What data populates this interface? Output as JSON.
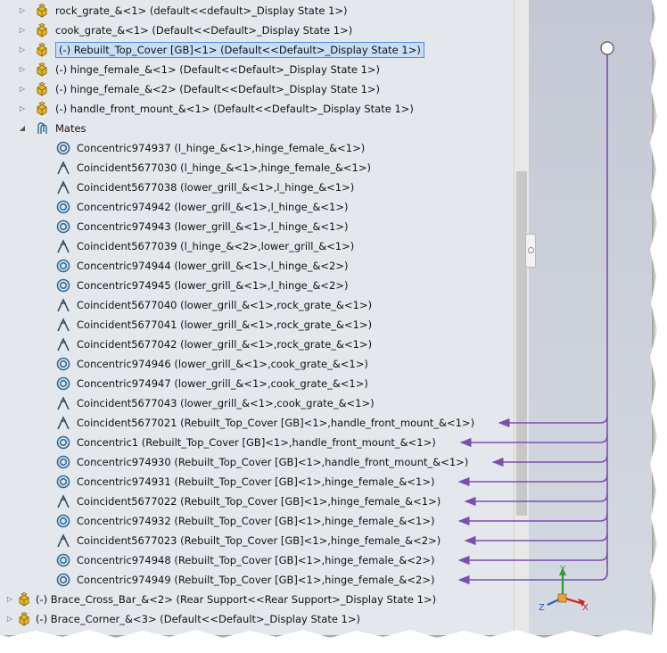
{
  "tree": {
    "rows": [
      {
        "label": "rock_grate_&<1> (default<<default>_Display State 1>)",
        "kind": "part",
        "expand": "right"
      },
      {
        "label": "cook_grate_&<1> (Default<<Default>_Display State 1>)",
        "kind": "part",
        "expand": "right"
      },
      {
        "label": "(-) Rebuilt_Top_Cover [GB]<1> (Default<<Default>_Display State 1>)",
        "kind": "part",
        "expand": "right",
        "selected": true
      },
      {
        "label": "(-) hinge_female_&<1> (Default<<Default>_Display State 1>)",
        "kind": "part",
        "expand": "right"
      },
      {
        "label": "(-) hinge_female_&<2> (Default<<Default>_Display State 1>)",
        "kind": "part",
        "expand": "right"
      },
      {
        "label": "(-) handle_front_mount_&<1> (Default<<Default>_Display State 1>)",
        "kind": "part",
        "expand": "right"
      },
      {
        "label": "Mates",
        "kind": "mates",
        "expand": "down"
      },
      {
        "label": "Concentric974937 (l_hinge_&<1>,hinge_female_&<1>)",
        "kind": "concentric"
      },
      {
        "label": "Coincident5677030 (l_hinge_&<1>,hinge_female_&<1>)",
        "kind": "coincident"
      },
      {
        "label": "Coincident5677038 (lower_grill_&<1>,l_hinge_&<1>)",
        "kind": "coincident"
      },
      {
        "label": "Concentric974942 (lower_grill_&<1>,l_hinge_&<1>)",
        "kind": "concentric"
      },
      {
        "label": "Concentric974943 (lower_grill_&<1>,l_hinge_&<1>)",
        "kind": "concentric"
      },
      {
        "label": "Coincident5677039 (l_hinge_&<2>,lower_grill_&<1>)",
        "kind": "coincident"
      },
      {
        "label": "Concentric974944 (lower_grill_&<1>,l_hinge_&<2>)",
        "kind": "concentric"
      },
      {
        "label": "Concentric974945 (lower_grill_&<1>,l_hinge_&<2>)",
        "kind": "concentric"
      },
      {
        "label": "Coincident5677040 (lower_grill_&<1>,rock_grate_&<1>)",
        "kind": "coincident"
      },
      {
        "label": "Coincident5677041 (lower_grill_&<1>,rock_grate_&<1>)",
        "kind": "coincident"
      },
      {
        "label": "Coincident5677042 (lower_grill_&<1>,rock_grate_&<1>)",
        "kind": "coincident"
      },
      {
        "label": "Concentric974946 (lower_grill_&<1>,cook_grate_&<1>)",
        "kind": "concentric"
      },
      {
        "label": "Concentric974947 (lower_grill_&<1>,cook_grate_&<1>)",
        "kind": "concentric"
      },
      {
        "label": "Coincident5677043 (lower_grill_&<1>,cook_grate_&<1>)",
        "kind": "coincident"
      },
      {
        "label": "Coincident5677021 (Rebuilt_Top_Cover [GB]<1>,handle_front_mount_&<1>)",
        "kind": "coincident",
        "arrow": true
      },
      {
        "label": "Concentric1 (Rebuilt_Top_Cover [GB]<1>,handle_front_mount_&<1>)",
        "kind": "concentric",
        "arrow": true
      },
      {
        "label": "Concentric974930 (Rebuilt_Top_Cover [GB]<1>,handle_front_mount_&<1>)",
        "kind": "concentric",
        "arrow": true
      },
      {
        "label": "Concentric974931 (Rebuilt_Top_Cover [GB]<1>,hinge_female_&<1>)",
        "kind": "concentric",
        "arrow": true
      },
      {
        "label": "Coincident5677022 (Rebuilt_Top_Cover [GB]<1>,hinge_female_&<1>)",
        "kind": "coincident",
        "arrow": true
      },
      {
        "label": "Concentric974932 (Rebuilt_Top_Cover [GB]<1>,hinge_female_&<1>)",
        "kind": "concentric",
        "arrow": true
      },
      {
        "label": "Coincident5677023 (Rebuilt_Top_Cover [GB]<1>,hinge_female_&<2>)",
        "kind": "coincident",
        "arrow": true
      },
      {
        "label": "Concentric974948 (Rebuilt_Top_Cover [GB]<1>,hinge_female_&<2>)",
        "kind": "concentric",
        "arrow": true
      },
      {
        "label": "Concentric974949 (Rebuilt_Top_Cover [GB]<1>,hinge_female_&<2>)",
        "kind": "concentric",
        "arrow": true
      },
      {
        "label": "(-) Brace_Cross_Bar_&<2> (Rear Support<<Rear Support>_Display State 1>)",
        "kind": "part",
        "expand": "right",
        "top_level": true
      },
      {
        "label": "(-) Brace_Corner_&<3> (Default<<Default>_Display State 1>)",
        "kind": "part",
        "expand": "right",
        "top_level": true
      }
    ]
  },
  "triad": {
    "y_label": "Y",
    "x_label": "X",
    "z_label": "Z"
  },
  "colors": {
    "arrow": "#7b4fb0",
    "mate_icon": "#2a6a9a",
    "part_icon": "#e8b526",
    "selection": "#c7def6"
  }
}
